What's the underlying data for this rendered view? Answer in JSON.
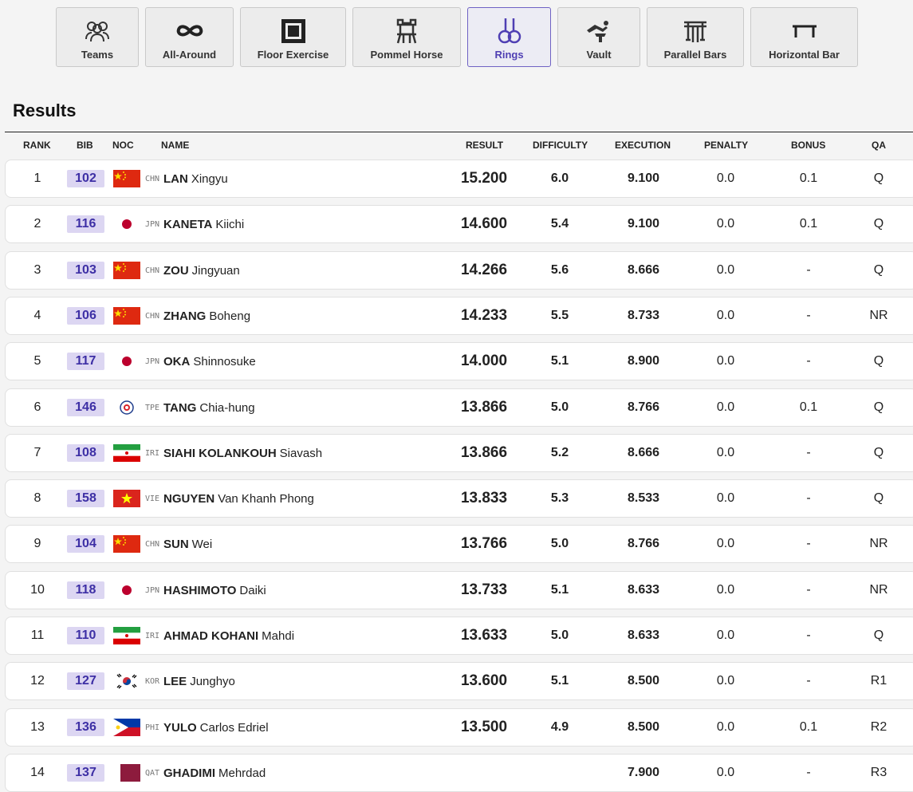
{
  "tabs": [
    {
      "label": "Teams",
      "icon": "teams-icon",
      "active": false
    },
    {
      "label": "All-Around",
      "icon": "infinity-icon",
      "active": false
    },
    {
      "label": "Floor Exercise",
      "icon": "floor-icon",
      "active": false
    },
    {
      "label": "Pommel Horse",
      "icon": "pommel-horse-icon",
      "active": false
    },
    {
      "label": "Rings",
      "icon": "rings-icon",
      "active": true
    },
    {
      "label": "Vault",
      "icon": "vault-icon",
      "active": false
    },
    {
      "label": "Parallel Bars",
      "icon": "parallel-bars-icon",
      "active": false
    },
    {
      "label": "Horizontal Bar",
      "icon": "horizontal-bar-icon",
      "active": false
    }
  ],
  "title": "Results",
  "columns": {
    "rank": "RANK",
    "bib": "BIB",
    "noc": "NOC",
    "name": "NAME",
    "result": "RESULT",
    "difficulty": "DIFFICULTY",
    "execution": "EXECUTION",
    "penalty": "PENALTY",
    "bonus": "BONUS",
    "qa": "QA"
  },
  "colors": {
    "accent": "#4f3fb3",
    "bib_bg": "#dcd6f2"
  },
  "rows": [
    {
      "rank": "1",
      "bib": "102",
      "noc": "CHN",
      "last": "LAN",
      "first": "Xingyu",
      "result": "15.200",
      "difficulty": "6.0",
      "execution": "9.100",
      "penalty": "0.0",
      "bonus": "0.1",
      "qa": "Q"
    },
    {
      "rank": "2",
      "bib": "116",
      "noc": "JPN",
      "last": "KANETA",
      "first": "Kiichi",
      "result": "14.600",
      "difficulty": "5.4",
      "execution": "9.100",
      "penalty": "0.0",
      "bonus": "0.1",
      "qa": "Q"
    },
    {
      "rank": "3",
      "bib": "103",
      "noc": "CHN",
      "last": "ZOU",
      "first": "Jingyuan",
      "result": "14.266",
      "difficulty": "5.6",
      "execution": "8.666",
      "penalty": "0.0",
      "bonus": "-",
      "qa": "Q"
    },
    {
      "rank": "4",
      "bib": "106",
      "noc": "CHN",
      "last": "ZHANG",
      "first": "Boheng",
      "result": "14.233",
      "difficulty": "5.5",
      "execution": "8.733",
      "penalty": "0.0",
      "bonus": "-",
      "qa": "NR"
    },
    {
      "rank": "5",
      "bib": "117",
      "noc": "JPN",
      "last": "OKA",
      "first": "Shinnosuke",
      "result": "14.000",
      "difficulty": "5.1",
      "execution": "8.900",
      "penalty": "0.0",
      "bonus": "-",
      "qa": "Q"
    },
    {
      "rank": "6",
      "bib": "146",
      "noc": "TPE",
      "last": "TANG",
      "first": "Chia-hung",
      "result": "13.866",
      "difficulty": "5.0",
      "execution": "8.766",
      "penalty": "0.0",
      "bonus": "0.1",
      "qa": "Q"
    },
    {
      "rank": "7",
      "bib": "108",
      "noc": "IRI",
      "last": "SIAHI KOLANKOUH",
      "first": "Siavash",
      "result": "13.866",
      "difficulty": "5.2",
      "execution": "8.666",
      "penalty": "0.0",
      "bonus": "-",
      "qa": "Q"
    },
    {
      "rank": "8",
      "bib": "158",
      "noc": "VIE",
      "last": "NGUYEN",
      "first": "Van Khanh Phong",
      "result": "13.833",
      "difficulty": "5.3",
      "execution": "8.533",
      "penalty": "0.0",
      "bonus": "-",
      "qa": "Q"
    },
    {
      "rank": "9",
      "bib": "104",
      "noc": "CHN",
      "last": "SUN",
      "first": "Wei",
      "result": "13.766",
      "difficulty": "5.0",
      "execution": "8.766",
      "penalty": "0.0",
      "bonus": "-",
      "qa": "NR"
    },
    {
      "rank": "10",
      "bib": "118",
      "noc": "JPN",
      "last": "HASHIMOTO",
      "first": "Daiki",
      "result": "13.733",
      "difficulty": "5.1",
      "execution": "8.633",
      "penalty": "0.0",
      "bonus": "-",
      "qa": "NR"
    },
    {
      "rank": "11",
      "bib": "110",
      "noc": "IRI",
      "last": "AHMAD KOHANI",
      "first": "Mahdi",
      "result": "13.633",
      "difficulty": "5.0",
      "execution": "8.633",
      "penalty": "0.0",
      "bonus": "-",
      "qa": "Q"
    },
    {
      "rank": "12",
      "bib": "127",
      "noc": "KOR",
      "last": "LEE",
      "first": "Junghyo",
      "result": "13.600",
      "difficulty": "5.1",
      "execution": "8.500",
      "penalty": "0.0",
      "bonus": "-",
      "qa": "R1"
    },
    {
      "rank": "13",
      "bib": "136",
      "noc": "PHI",
      "last": "YULO",
      "first": "Carlos Edriel",
      "result": "13.500",
      "difficulty": "4.9",
      "execution": "8.500",
      "penalty": "0.0",
      "bonus": "0.1",
      "qa": "R2"
    },
    {
      "rank": "14",
      "bib": "137",
      "noc": "QAT",
      "last": "GHADIMI",
      "first": "Mehrdad",
      "result": "",
      "difficulty": "",
      "execution": "7.900",
      "penalty": "0.0",
      "bonus": "-",
      "qa": "R3"
    }
  ]
}
